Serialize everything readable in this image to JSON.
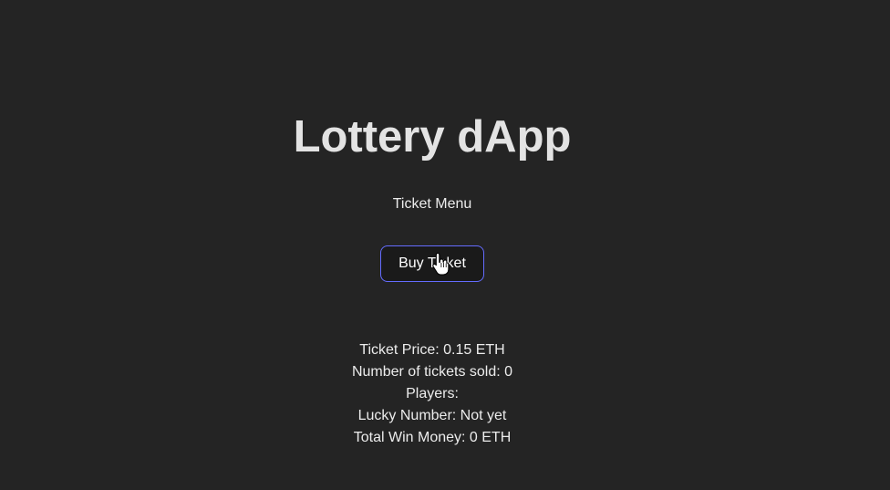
{
  "header": {
    "title": "Lottery dApp"
  },
  "menu": {
    "label": "Ticket Menu",
    "buy_button_label": "Buy Ticket"
  },
  "info": {
    "ticket_price": "Ticket Price: 0.15 ETH",
    "tickets_sold": "Number of tickets sold: 0",
    "players": "Players:",
    "lucky_number": "Lucky Number: Not yet",
    "total_win_money": "Total Win Money: 0 ETH"
  },
  "colors": {
    "background": "#242424",
    "text": "#ececec",
    "title": "#e3e3e3",
    "button_border": "#646cff",
    "button_background": "#1a1a1a"
  },
  "icons": {
    "cursor": "hand-pointer-cursor-icon"
  }
}
